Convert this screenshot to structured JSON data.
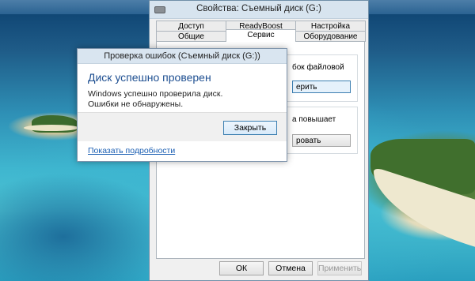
{
  "properties_window": {
    "title": "Свойства: Съемный диск (G:)",
    "tabs_row1": [
      "Доступ",
      "ReadyBoost",
      "Настройка"
    ],
    "tabs_row2": [
      "Общие",
      "Сервис",
      "Оборудование"
    ],
    "active_tab": "Сервис",
    "group1_text": "бок файловой",
    "group1_button": "ерить",
    "group2_text": "а повышает",
    "group2_button": "ровать",
    "buttons": {
      "ok": "ОК",
      "cancel": "Отмена",
      "apply": "Применить"
    }
  },
  "dialog": {
    "title": "Проверка ошибок (Съемный диск (G:))",
    "heading": "Диск успешно проверен",
    "message": "Windows успешно проверила диск. Ошибки не обнаружены.",
    "close_button": "Закрыть",
    "details_link": "Показать подробности"
  },
  "colors": {
    "heading": "#1e4f91",
    "link": "#1b5fb3",
    "titlebar": "#d7e4ef"
  }
}
